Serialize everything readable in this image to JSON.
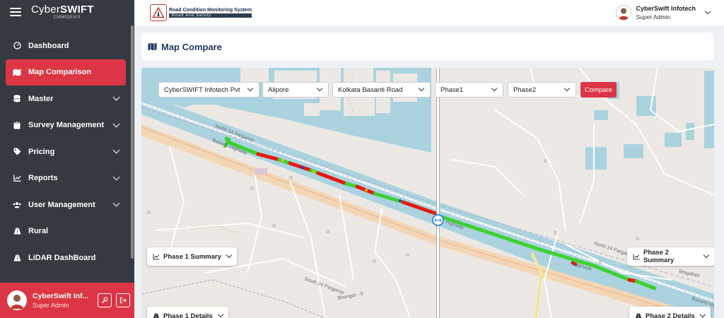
{
  "sidebar": {
    "logo_main_a": "Cyber",
    "logo_main_b": "SWIFT",
    "logo_sub": "CMMIDEV/3",
    "items": [
      {
        "label": "Dashboard",
        "icon": "dashboard-icon",
        "active": false,
        "has_sub": false
      },
      {
        "label": "Map Comparison",
        "icon": "map-icon",
        "active": true,
        "has_sub": false
      },
      {
        "label": "Master",
        "icon": "database-icon",
        "active": false,
        "has_sub": true
      },
      {
        "label": "Survey Management",
        "icon": "clipboard-icon",
        "active": false,
        "has_sub": true
      },
      {
        "label": "Pricing",
        "icon": "tag-icon",
        "active": false,
        "has_sub": true
      },
      {
        "label": "Reports",
        "icon": "chart-icon",
        "active": false,
        "has_sub": true
      },
      {
        "label": "User Management",
        "icon": "users-icon",
        "active": false,
        "has_sub": true
      },
      {
        "label": "Rural",
        "icon": "road-icon",
        "active": false,
        "has_sub": false
      },
      {
        "label": "LiDAR DashBoard",
        "icon": "road-icon",
        "active": false,
        "has_sub": false
      }
    ],
    "user": {
      "name": "CyberSwift Inf...",
      "role": "Super Admin"
    }
  },
  "topbar": {
    "brand_title": "Road Condition Monitoring System",
    "brand_tagline": "Road and Safety",
    "user_name": "CyberSwift Infotech",
    "user_role": "Super Admin"
  },
  "page": {
    "title": "Map Compare"
  },
  "filters": {
    "company": "CyberSWIFT Infotech Pvt",
    "area": "Alipore",
    "road": "Kolkata Basanti Road",
    "phase_left": "Phase1",
    "phase_right": "Phase2",
    "compare_label": "Compare"
  },
  "map": {
    "labels": {
      "north24_top": "North 24 Parganas",
      "basanti_left": "Basanti Highway",
      "north24_right": "North 24 Parganas",
      "bhajahari": "Bhajahari",
      "basanti_right": "Basanti Hig",
      "south24": "South 24 Parganas",
      "bhangar": "Bhangar - II",
      "highway_mid": "Highway",
      "jagkha": "Jagkharlk"
    },
    "panels": {
      "phase1_summary": "Phase 1 Summary",
      "phase2_summary": "Phase 2 Summary",
      "phase1_details": "Phase 1 Details",
      "phase2_details": "Phase 2 Details"
    },
    "colors": {
      "water": "#aad3df",
      "land": "#ece9e4",
      "road_major": "#f5c59a",
      "good": "#3dd12f",
      "bad": "#e8170c",
      "mid": "#f0c000",
      "accent": "#dc3545"
    }
  }
}
